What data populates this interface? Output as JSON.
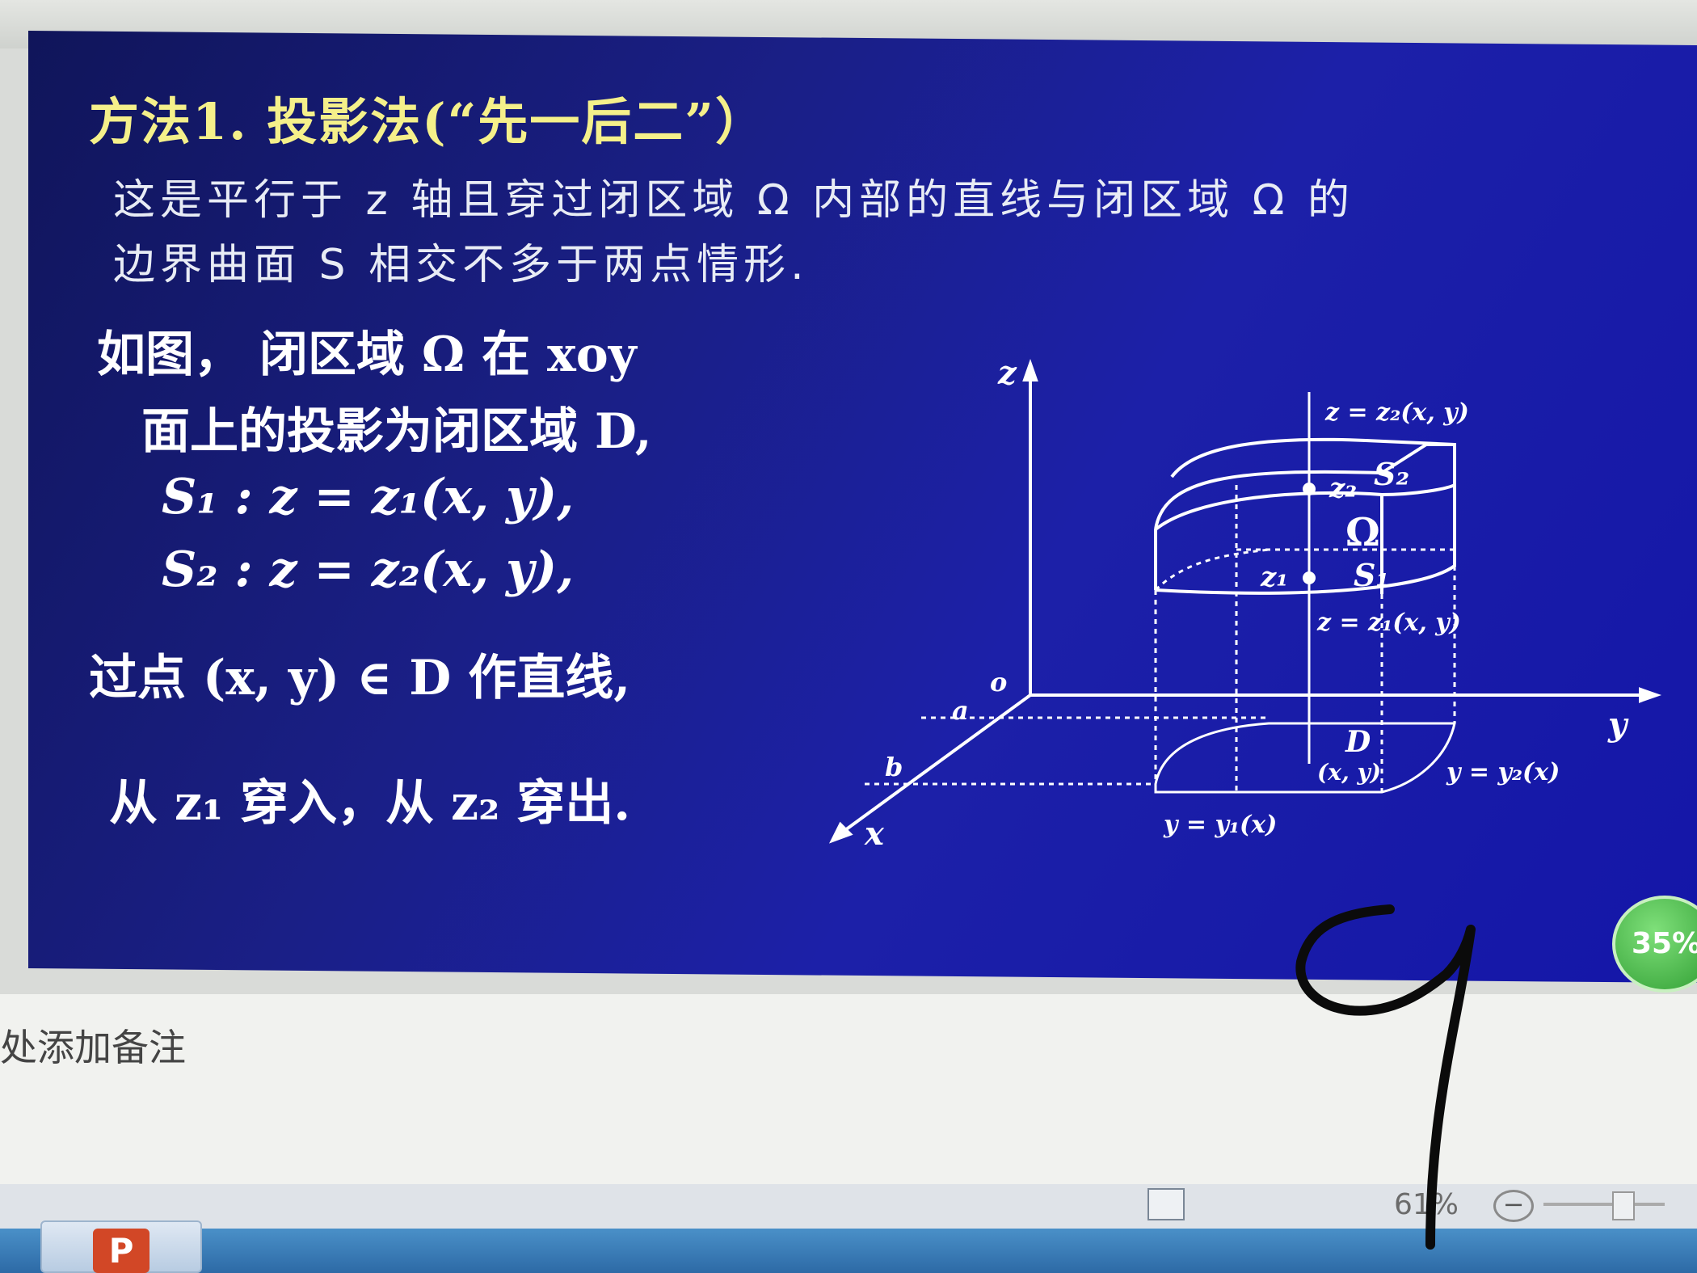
{
  "slide": {
    "title": "方法1. 投影法(“先一后二”）",
    "para_line1": "这是平行于 z 轴且穿过闭区域 Ω 内部的直线与闭区域 Ω 的",
    "para_line2": "边界曲面 S 相交不多于两点情形.",
    "body_line1": "如图，  闭区域 Ω 在 xoy",
    "body_line2": "面上的投影为闭区域 D,",
    "body_line3": "S₁ :   z = z₁(x, y),",
    "body_line4": "S₂ :   z = z₂(x, y),",
    "body_line5": "过点 (x, y) ∈ D 作直线,",
    "body_line6": "从 z₁ 穿入，从 z₂ 穿出."
  },
  "diagram": {
    "axis_z": "z",
    "axis_y": "y",
    "axis_x": "x",
    "origin": "o",
    "tick_a": "a",
    "tick_b": "b",
    "top_surface_eq": "z = z₂(x, y)",
    "top_point": "z₂",
    "top_surface": "S₂",
    "region": "Ω",
    "bottom_point": "z₁",
    "bottom_surface": "S₁",
    "bottom_surface_eq": "z = z₁(x, y)",
    "domain": "D",
    "domain_point": "(x, y)",
    "curve_y2": "y = y₂(x)",
    "curve_y1": "y = y₁(x)"
  },
  "notes": {
    "placeholder": "处添加备注"
  },
  "statusbar": {
    "zoom": "61%",
    "zoom_minus": "−"
  },
  "badge": {
    "value": "35%"
  },
  "taskbar": {
    "ppt_label": "P"
  },
  "colors": {
    "slide_bg": "#1a1f9a",
    "title": "#f5f08a",
    "text": "#ffffff"
  }
}
